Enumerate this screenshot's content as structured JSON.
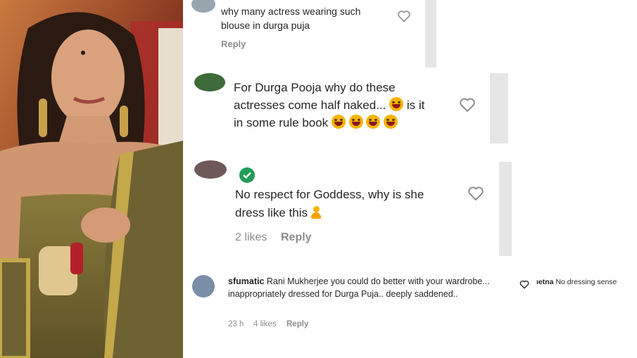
{
  "comments": [
    {
      "text": "why many actress wearing such blouse in durga puja",
      "reply_label": "Reply"
    },
    {
      "text_line1": "For Durga Pooja why do these",
      "text_line2": "actresses come half naked...",
      "text_line2_end": "is it",
      "text_line3": "in some rule book"
    },
    {
      "text_line1": "No respect for Goddess, why is she",
      "text_line2": "dress like this",
      "likes": "2 likes",
      "reply_label": "Reply"
    },
    {
      "username": "sfumatic",
      "text": "Rani Mukherjee you could do better with your wardrobe... inappropriately dressed for Durga Puja.. deeply saddened..",
      "time": "23 h",
      "likes": "4 likes",
      "reply_label": "Reply"
    },
    {
      "username_fragment": "ıetna",
      "text": "No dressing sense"
    }
  ],
  "colors": {
    "text": "#262626",
    "meta": "#8e8e8e",
    "verified_badge": "#1f9d55",
    "emoji": "#f5b400"
  },
  "icons": [
    "heart-outline-icon",
    "verified-check-icon",
    "laughing-emoji-icon",
    "thinking-emoji-icon",
    "person-emoji-icon"
  ]
}
